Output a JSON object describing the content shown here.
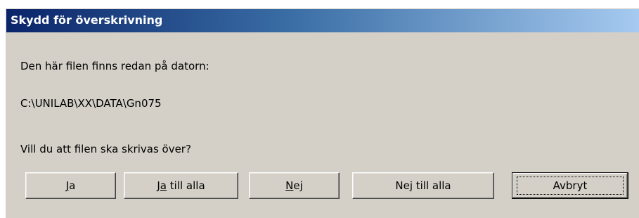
{
  "dialog": {
    "title": "Skydd för överskrivning",
    "message_line1": "Den här filen finns redan på datorn:",
    "file_path": "C:\\UNILAB\\XX\\DATA\\Gn075",
    "question": "Vill du att filen ska skrivas över?"
  },
  "buttons": {
    "yes": {
      "pre": "",
      "mnemonic": "J",
      "post": "a"
    },
    "yes_all": {
      "pre": "J",
      "mnemonic": "a",
      "post": " till alla"
    },
    "no": {
      "pre": "",
      "mnemonic": "N",
      "post": "ej"
    },
    "no_all": {
      "pre": "Ne",
      "mnemonic": "j",
      "post": " till alla"
    },
    "cancel": {
      "label": "Avbryt"
    }
  },
  "colors": {
    "titlebar_start": "#0a246a",
    "titlebar_end": "#a6caf0",
    "dialog_bg": "#d4d0c8"
  }
}
